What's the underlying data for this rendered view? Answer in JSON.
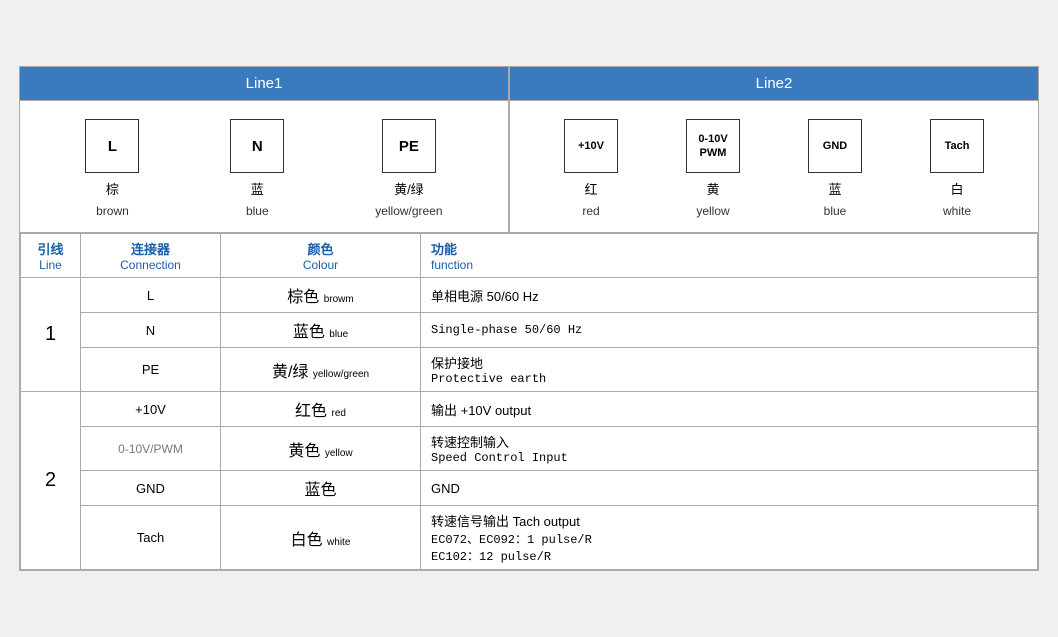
{
  "header": {
    "line1_label": "Line1",
    "line2_label": "Line2"
  },
  "line1_connectors": [
    {
      "symbol": "L",
      "cn": "棕",
      "en": "brown"
    },
    {
      "symbol": "N",
      "cn": "蓝",
      "en": "blue"
    },
    {
      "symbol": "PE",
      "cn": "黄/绿",
      "en": "yellow/green"
    }
  ],
  "line2_connectors": [
    {
      "symbol": "+10V",
      "cn": "红",
      "en": "red"
    },
    {
      "symbol": "0-10V\nPWM",
      "cn": "黄",
      "en": "yellow"
    },
    {
      "symbol": "GND",
      "cn": "蓝",
      "en": "blue"
    },
    {
      "symbol": "Tach",
      "cn": "白",
      "en": "white"
    }
  ],
  "table_headers": {
    "line_cn": "引线",
    "line_en": "Line",
    "connection_cn": "连接器",
    "connection_en": "Connection",
    "colour_cn": "颜色",
    "colour_en": "Colour",
    "function_cn": "功能",
    "function_en": "function"
  },
  "rows": [
    {
      "line": "1",
      "rowspan": 3,
      "connections": [
        {
          "connector": "L",
          "colour_cn": "棕色",
          "colour_en": "browm",
          "function_cn": "单相电源 50/60 Hz",
          "function_en": null
        },
        {
          "connector": "N",
          "colour_cn": "蓝色",
          "colour_en": "blue",
          "function_cn": null,
          "function_en": "Single-phase 50/60 Hz"
        },
        {
          "connector": "PE",
          "colour_cn": "黄/绿",
          "colour_en": "yellow/green",
          "function_cn": "保护接地",
          "function_en": "Protective earth"
        }
      ]
    },
    {
      "line": "2",
      "rowspan": 4,
      "connections": [
        {
          "connector": "+10V",
          "colour_cn": "红色",
          "colour_en": "red",
          "function_cn": "输出 +10V output",
          "function_en": null
        },
        {
          "connector": "0-10V/PWM",
          "colour_cn": "黄色",
          "colour_en": "yellow",
          "function_cn": "转速控制输入",
          "function_en": "Speed Control Input"
        },
        {
          "connector": "GND",
          "colour_cn": "蓝色",
          "colour_en": null,
          "function_cn": "GND",
          "function_en": null
        },
        {
          "connector": "Tach",
          "colour_cn": "白色",
          "colour_en": "white",
          "function_cn": "转速信号输出 Tach output",
          "function_en": "EC072、EC092：1 pulse/R\nEC102：12 pulse/R"
        }
      ]
    }
  ]
}
